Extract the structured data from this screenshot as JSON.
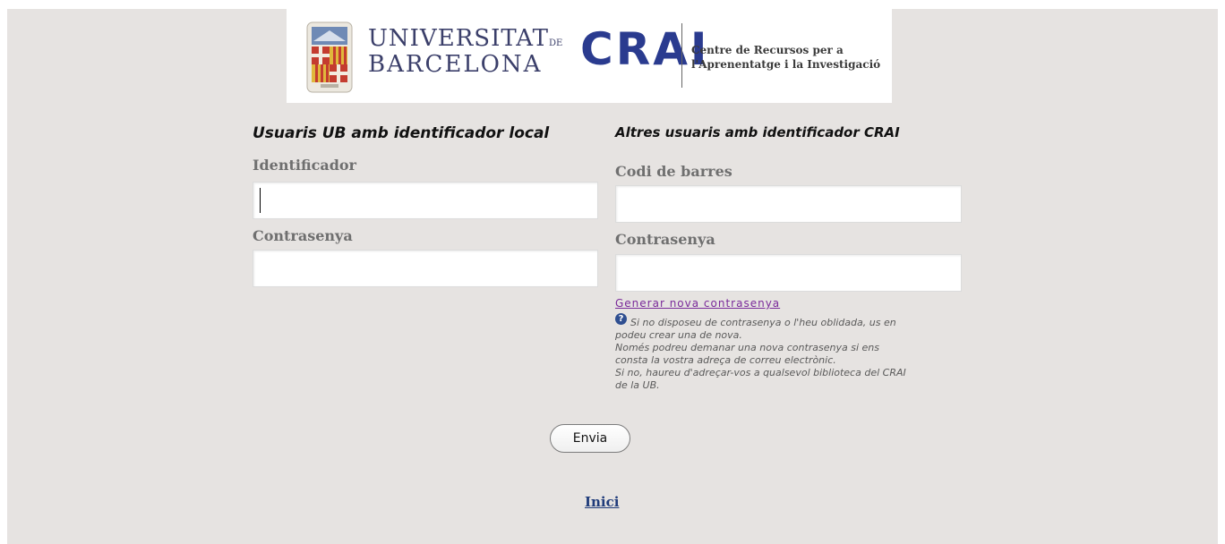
{
  "header": {
    "university_line1": "UNIVERSITAT",
    "university_de": "DE",
    "university_line2": "BARCELONA",
    "crai_word": "CRAI",
    "crai_sub_line1": "Centre de Recursos per a",
    "crai_sub_line2": "l'Aprenentatge i la Investigació",
    "seal_icon": "university-seal-icon"
  },
  "left_form": {
    "heading": "Usuaris UB amb identificador local",
    "id_label": "Identificador",
    "id_value": "",
    "password_label": "Contrasenya",
    "password_value": ""
  },
  "right_form": {
    "heading": "Altres usuaris amb identificador CRAI",
    "barcode_label": "Codi de barres",
    "barcode_value": "",
    "password_label": "Contrasenya",
    "password_value": "",
    "reset_link": "Generar nova contrasenya",
    "help_icon": "question-icon",
    "help_lines": [
      "Si no disposeu de contrasenya o l'heu oblidada, us en",
      "podeu crear una de nova.",
      "Només podreu demanar una nova contrasenya si ens",
      "consta la vostra adreça de correu electrònic.",
      "Si no, haureu d'adreçar-vos a qualsevol biblioteca del CRAI",
      "de la UB."
    ]
  },
  "actions": {
    "submit_label": "Envia",
    "home_link": "Inici"
  },
  "colors": {
    "page_background": "#e6e3e1",
    "heading": "#111111",
    "label": "#6f6f6f",
    "logo_navy": "#2a3b8f",
    "link_visited": "#7a2a9a",
    "link_home": "#1f3b7a"
  }
}
